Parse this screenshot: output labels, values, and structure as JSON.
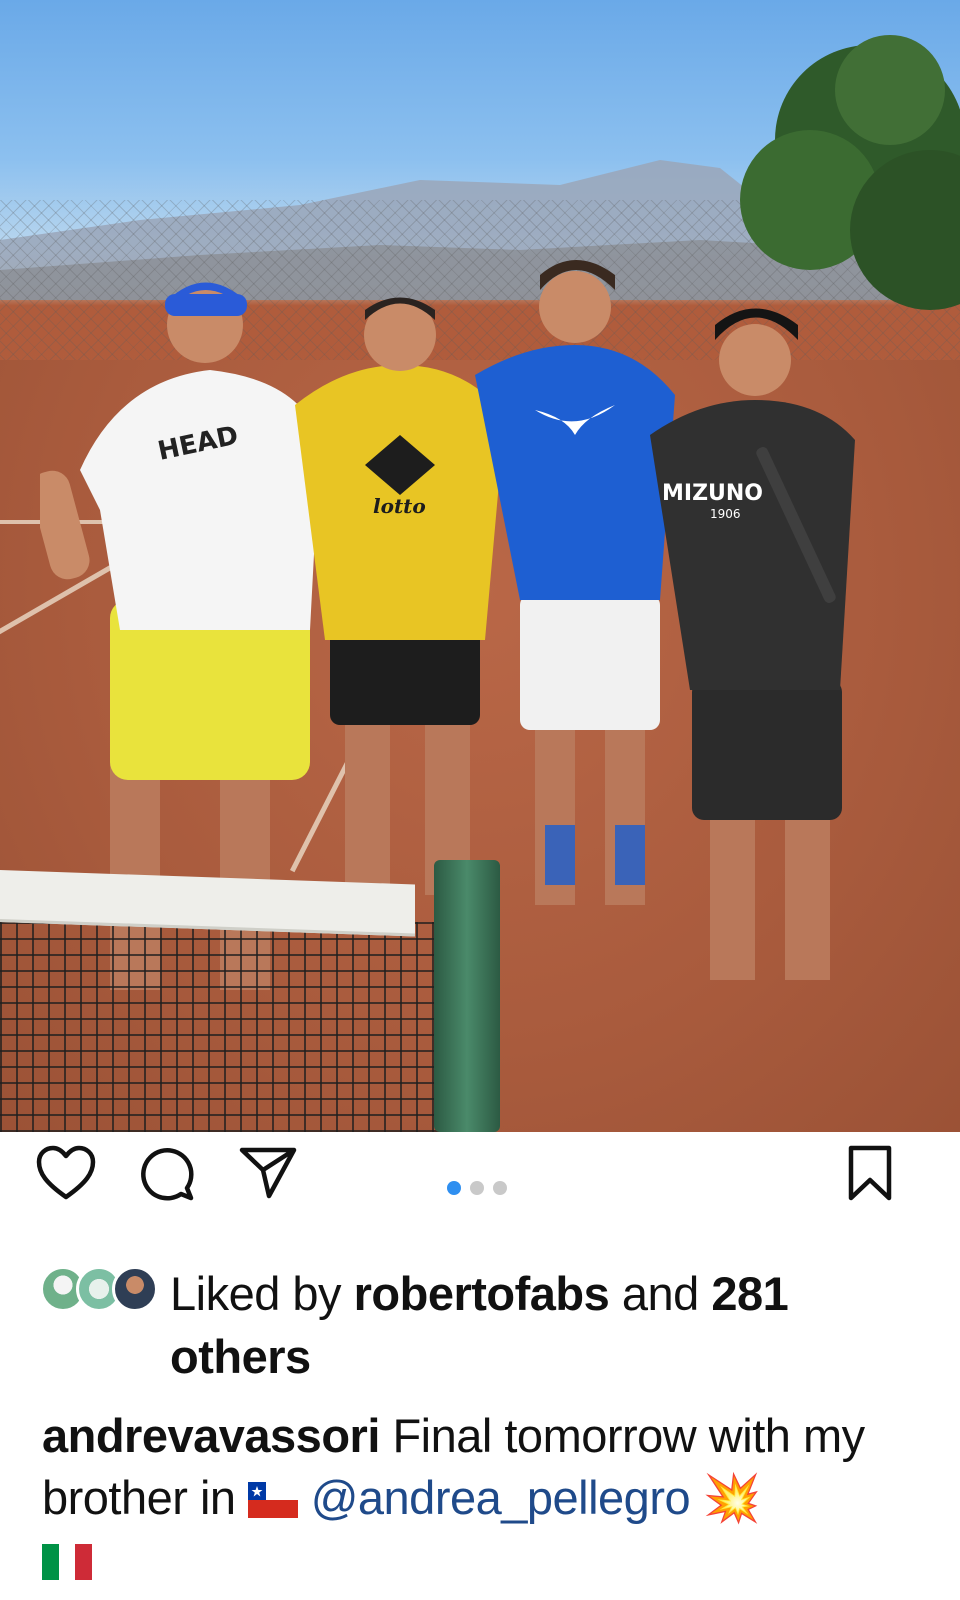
{
  "post": {
    "image_alt": "Four tennis players standing on a clay court behind a net",
    "carousel": {
      "count": 3,
      "active_index": 0
    }
  },
  "actions": {
    "like_icon": "heart-icon",
    "comment_icon": "comment-icon",
    "share_icon": "paper-plane-icon",
    "save_icon": "bookmark-icon"
  },
  "likes": {
    "prefix": "Liked by ",
    "user": "robertofabs",
    "middle": " and ",
    "count": "281",
    "suffix": " others"
  },
  "caption": {
    "username": "andrevavassori",
    "text_before_flag": " Final tomorrow with my brother in ",
    "mention": "@andrea_pellegro",
    "emoji_1": "💥"
  },
  "colors": {
    "accent_blue": "#2f8ff0",
    "mention_blue": "#1f4a8a",
    "text": "#111111"
  }
}
